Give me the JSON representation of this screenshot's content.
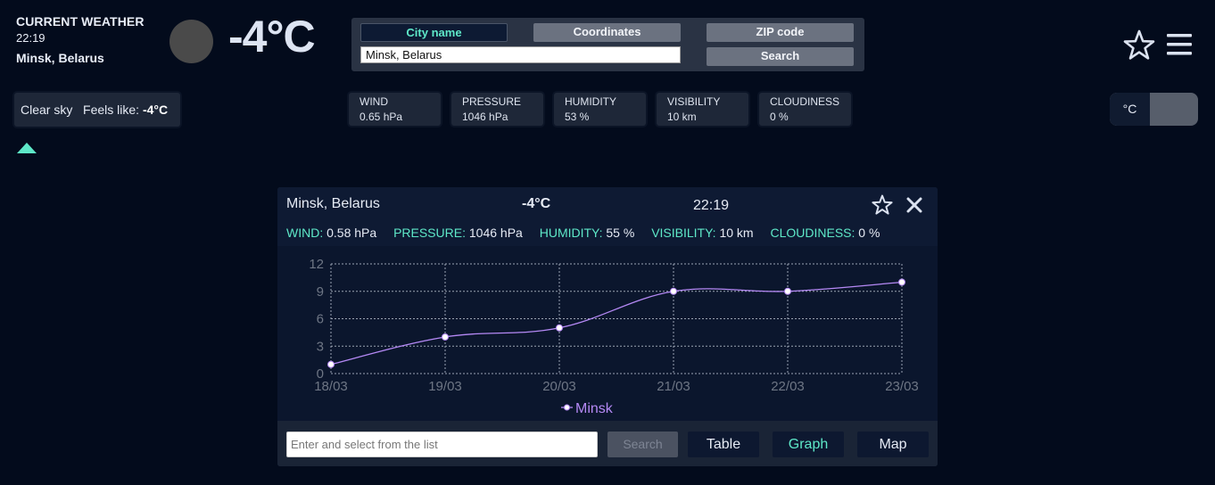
{
  "header": {
    "title": "CURRENT WEATHER",
    "time": "22:19",
    "location": "Minsk, Belarus",
    "temperature": "-4°C",
    "weather_icon": "clear-sky-circle"
  },
  "search_panel": {
    "tabs": [
      "City name",
      "Coordinates",
      "ZIP code"
    ],
    "active_tab": "City name",
    "city_value": "Minsk, Belarus",
    "search_label": "Search"
  },
  "top_icons": [
    "star-icon",
    "hamburger-menu-icon"
  ],
  "summary": {
    "sky": "Clear sky",
    "feels_like_label": "Feels like:",
    "feels_like_value": "-4°C"
  },
  "stats": [
    {
      "label": "WIND",
      "value": "0.65 hPa"
    },
    {
      "label": "PRESSURE",
      "value": "1046 hPa"
    },
    {
      "label": "HUMIDITY",
      "value": "53 %"
    },
    {
      "label": "VISIBILITY",
      "value": "10 km"
    },
    {
      "label": "CLOUDINESS",
      "value": "0 %"
    }
  ],
  "unit_toggle": {
    "selected": "°C"
  },
  "colors": {
    "accent": "#5ee8c8",
    "background": "#030b1c",
    "series": "#b589f5"
  },
  "card": {
    "city": "Minsk, Belarus",
    "temperature": "-4°C",
    "time": "22:19",
    "stats": {
      "wind_label": "WIND:",
      "wind_value": "0.58 hPa",
      "pressure_label": "PRESSURE:",
      "pressure_value": "1046 hPa",
      "humidity_label": "HUMIDITY:",
      "humidity_value": "55 %",
      "visibility_label": "VISIBILITY:",
      "visibility_value": "10 km",
      "cloudiness_label": "CLOUDINESS:",
      "cloudiness_value": "0 %"
    },
    "footer": {
      "placeholder": "Enter and select from the list",
      "search_label": "Search",
      "table_label": "Table",
      "graph_label": "Graph",
      "map_label": "Map",
      "active_view": "Graph"
    }
  },
  "chart_data": {
    "type": "line",
    "categories": [
      "18/03",
      "19/03",
      "20/03",
      "21/03",
      "22/03",
      "23/03"
    ],
    "series": [
      {
        "name": "Minsk",
        "values": [
          1,
          4,
          5,
          9,
          9,
          10
        ]
      }
    ],
    "ylim": [
      0,
      12
    ],
    "yticks": [
      0,
      3,
      6,
      9,
      12
    ],
    "grid": true,
    "legend": "bottom"
  }
}
